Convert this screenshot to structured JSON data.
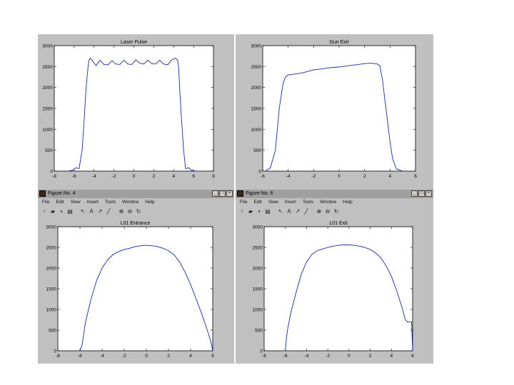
{
  "windows": [
    {
      "id": "w1",
      "has_chrome": false,
      "chart": {
        "title": "Laser Pulse",
        "xlim": [
          -8,
          8
        ],
        "ylim": [
          0,
          3000
        ],
        "xticks": [
          "-8",
          "-6",
          "-4",
          "-2",
          "0",
          "2",
          "4",
          "6",
          "8"
        ],
        "yticks": [
          "0",
          "500",
          "1000",
          "1500",
          "2000",
          "2500",
          "3000"
        ]
      }
    },
    {
      "id": "w2",
      "has_chrome": false,
      "chart": {
        "title": "Gun Exit",
        "xlim": [
          -6,
          6
        ],
        "ylim": [
          0,
          3000
        ],
        "xticks": [
          "-6",
          "-4",
          "-2",
          "0",
          "2",
          "4",
          "6"
        ],
        "yticks": [
          "0",
          "500",
          "1000",
          "1500",
          "2000",
          "2500",
          "3000"
        ]
      }
    },
    {
      "id": "w3",
      "has_chrome": true,
      "window_title": "Figure No. 4",
      "menu": [
        "File",
        "Edit",
        "View",
        "Insert",
        "Tools",
        "Window",
        "Help"
      ],
      "chart": {
        "title": "L01 Entrance",
        "xlim": [
          -8,
          6
        ],
        "ylim": [
          0,
          3000
        ],
        "xticks": [
          "-8",
          "-6",
          "-4",
          "-2",
          "0",
          "2",
          "4",
          "6"
        ],
        "yticks": [
          "0",
          "500",
          "1000",
          "1500",
          "2000",
          "2500",
          "3000"
        ]
      }
    },
    {
      "id": "w4",
      "has_chrome": true,
      "window_title": "Figure No. 6",
      "menu": [
        "File",
        "Edit",
        "View",
        "Insert",
        "Tools",
        "Window",
        "Help"
      ],
      "chart": {
        "title": "L01 Exit",
        "xlim": [
          -8,
          6
        ],
        "ylim": [
          0,
          3000
        ],
        "xticks": [
          "-8",
          "-6",
          "-4",
          "-2",
          "0",
          "2",
          "4",
          "6"
        ],
        "yticks": [
          "0",
          "500",
          "1000",
          "1500",
          "2000",
          "2500",
          "3000"
        ]
      }
    }
  ],
  "chart_data": [
    {
      "type": "line",
      "title": "Laser Pulse",
      "xlim": [
        -8,
        8
      ],
      "ylim": [
        0,
        3000
      ],
      "color": "#1a2aa0",
      "x": [
        -6.6,
        -6.2,
        -5.8,
        -5.5,
        -5.2,
        -5.0,
        -4.8,
        -4.6,
        -4.5,
        -4.4,
        -4.2,
        -3.8,
        -3.4,
        -3.0,
        -2.6,
        -2.2,
        -1.8,
        -1.4,
        -1.0,
        -0.6,
        -0.2,
        0.2,
        0.6,
        1.0,
        1.4,
        1.8,
        2.2,
        2.6,
        3.0,
        3.4,
        3.8,
        4.2,
        4.4,
        4.5,
        4.6,
        4.8,
        5.0,
        5.2,
        5.5,
        5.8,
        6.2,
        6.6
      ],
      "y": [
        0,
        20,
        80,
        60,
        500,
        1200,
        2000,
        2500,
        2650,
        2700,
        2650,
        2520,
        2650,
        2550,
        2540,
        2640,
        2560,
        2550,
        2650,
        2560,
        2550,
        2660,
        2580,
        2560,
        2650,
        2570,
        2560,
        2650,
        2560,
        2540,
        2660,
        2700,
        2650,
        2500,
        2000,
        1200,
        500,
        60,
        80,
        20,
        0,
        0
      ]
    },
    {
      "type": "line",
      "title": "Gun Exit",
      "xlim": [
        -6,
        6
      ],
      "ylim": [
        0,
        3000
      ],
      "color": "#1a2aa0",
      "x": [
        -5.8,
        -5.4,
        -5.0,
        -4.7,
        -4.4,
        -4.2,
        -4.0,
        -3.5,
        -3.0,
        -2.5,
        -2.0,
        -1.5,
        -1.0,
        -0.5,
        0.0,
        0.5,
        1.0,
        1.5,
        2.0,
        2.5,
        3.0,
        3.2,
        3.4,
        3.6,
        3.8,
        4.0,
        4.2,
        4.5,
        5.0
      ],
      "y": [
        0,
        80,
        500,
        1500,
        2100,
        2250,
        2300,
        2320,
        2340,
        2380,
        2420,
        2440,
        2460,
        2480,
        2490,
        2510,
        2530,
        2550,
        2570,
        2580,
        2560,
        2520,
        2200,
        1700,
        1200,
        700,
        300,
        50,
        0
      ]
    },
    {
      "type": "line",
      "title": "L01 Entrance",
      "xlim": [
        -8,
        6
      ],
      "ylim": [
        0,
        3000
      ],
      "color": "#1a2aa0",
      "x": [
        -6.0,
        -5.8,
        -5.5,
        -5.0,
        -4.5,
        -4.0,
        -3.5,
        -3.0,
        -2.5,
        -2.0,
        -1.5,
        -1.0,
        -0.5,
        0.0,
        0.5,
        1.0,
        1.5,
        2.0,
        2.5,
        3.0,
        3.5,
        4.0,
        4.5,
        5.0,
        5.5,
        5.8,
        6.0
      ],
      "y": [
        0,
        150,
        700,
        1250,
        1700,
        2000,
        2200,
        2330,
        2400,
        2450,
        2480,
        2520,
        2540,
        2550,
        2540,
        2520,
        2480,
        2420,
        2320,
        2150,
        1900,
        1600,
        1250,
        900,
        500,
        250,
        0
      ]
    },
    {
      "type": "line",
      "title": "L01 Exit",
      "xlim": [
        -8,
        6
      ],
      "ylim": [
        0,
        3000
      ],
      "color": "#1a2aa0",
      "x": [
        -6.0,
        -5.9,
        -5.8,
        -5.5,
        -5.0,
        -4.5,
        -4.0,
        -3.5,
        -3.0,
        -2.5,
        -2.0,
        -1.5,
        -1.0,
        -0.5,
        0.0,
        0.5,
        1.0,
        1.5,
        2.0,
        2.5,
        3.0,
        3.5,
        4.0,
        4.5,
        5.0,
        5.3,
        5.5,
        5.6,
        5.9,
        6.0
      ],
      "y": [
        0,
        300,
        500,
        900,
        1400,
        1850,
        2150,
        2330,
        2420,
        2460,
        2500,
        2530,
        2550,
        2560,
        2560,
        2550,
        2530,
        2500,
        2450,
        2370,
        2250,
        2050,
        1800,
        1450,
        1050,
        760,
        700,
        700,
        700,
        0
      ]
    }
  ]
}
